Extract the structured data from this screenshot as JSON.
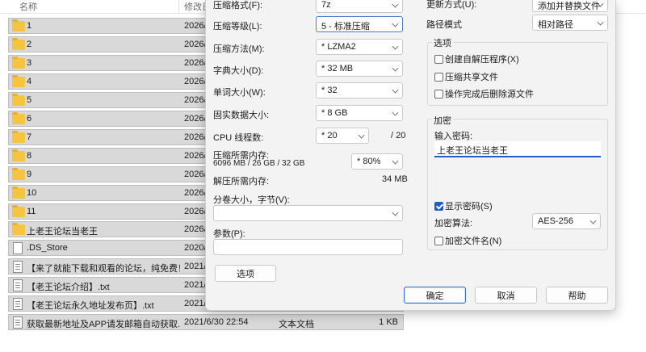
{
  "explorer": {
    "header": {
      "name": "名称",
      "date": "修改日"
    },
    "files": [
      {
        "name": "1",
        "date": "2026/",
        "type": "",
        "size": "",
        "icon": "folder-icon"
      },
      {
        "name": "2",
        "date": "2026/",
        "type": "",
        "size": "",
        "icon": "folder-icon"
      },
      {
        "name": "3",
        "date": "2026/",
        "type": "",
        "size": "",
        "icon": "folder-icon"
      },
      {
        "name": "4",
        "date": "2026/",
        "type": "",
        "size": "",
        "icon": "folder-icon"
      },
      {
        "name": "5",
        "date": "2026/",
        "type": "",
        "size": "",
        "icon": "folder-icon"
      },
      {
        "name": "6",
        "date": "2026/",
        "type": "",
        "size": "",
        "icon": "folder-icon"
      },
      {
        "name": "7",
        "date": "2026/",
        "type": "",
        "size": "",
        "icon": "folder-icon"
      },
      {
        "name": "8",
        "date": "2026/",
        "type": "",
        "size": "",
        "icon": "folder-icon"
      },
      {
        "name": "9",
        "date": "2026/",
        "type": "",
        "size": "",
        "icon": "folder-icon"
      },
      {
        "name": "10",
        "date": "2026/",
        "type": "",
        "size": "",
        "icon": "folder-icon"
      },
      {
        "name": "11",
        "date": "2026/",
        "type": "",
        "size": "",
        "icon": "folder-icon"
      },
      {
        "name": "上老王论坛当老王",
        "date": "2026/",
        "type": "",
        "size": "",
        "icon": "folder-icon"
      },
      {
        "name": ".DS_Store",
        "date": "2020/",
        "type": "",
        "size": "",
        "icon": "document-icon"
      },
      {
        "name": "【来了就能下载和观看的论坛，纯免费！...",
        "date": "2021/",
        "type": "",
        "size": "",
        "icon": "text-file-icon"
      },
      {
        "name": "【老王论坛介绍】.txt",
        "date": "2021/",
        "type": "",
        "size": "",
        "icon": "text-file-icon"
      },
      {
        "name": "【老王论坛永久地址发布页】.txt",
        "date": "2021/",
        "type": "",
        "size": "",
        "icon": "text-file-icon"
      },
      {
        "name": "获取最新地址及APP请发邮箱自动获取.txt",
        "date": "2021/6/30 22:54",
        "type": "文本文档",
        "size": "1 KB",
        "icon": "text-file-icon"
      }
    ]
  },
  "dialog": {
    "left": {
      "format_label": "压缩格式(F):",
      "format_value": "7z",
      "level_label": "压缩等级(L):",
      "level_value": "5 - 标准压缩",
      "method_label": "压缩方法(M):",
      "method_value": "* LZMA2",
      "dict_label": "字典大小(D):",
      "dict_value": "* 32 MB",
      "word_label": "单词大小(W):",
      "word_value": "* 32",
      "solid_label": "固实数据大小:",
      "solid_value": "* 8 GB",
      "threads_label": "CPU 线程数:",
      "threads_value": "* 20",
      "threads_max": "/ 20",
      "mem_label": "压缩所需内存:",
      "mem_detail": "6096 MB / 26 GB / 32 GB",
      "mem_percent": "* 80%",
      "decomp_label": "解压所需内存:",
      "decomp_value": "34 MB",
      "split_label": "分卷大小，字节(V):",
      "split_value": "",
      "params_label": "参数(P):",
      "params_value": "",
      "options_button": "选项"
    },
    "right": {
      "update_label": "更新方式(U):",
      "update_value": "添加并替换文件",
      "path_label": "路径模式",
      "path_value": "相对路径",
      "options_group": "选项",
      "opt_sfx": "创建自解压程序(X)",
      "opt_shared": "压缩共享文件",
      "opt_delete": "操作完成后删除源文件",
      "encrypt_group": "加密",
      "password_label": "输入密码:",
      "password_value": "上老王论坛当老王",
      "show_password": "显示密码(S)",
      "algo_label": "加密算法:",
      "algo_value": "AES-256",
      "encrypt_names": "加密文件名(N)"
    },
    "buttons": {
      "ok": "确定",
      "cancel": "取消",
      "help": "帮助"
    }
  },
  "colors": {
    "accent": "#1f5fbf",
    "folder": "#f5c542",
    "selection": "#d9d9d9"
  }
}
